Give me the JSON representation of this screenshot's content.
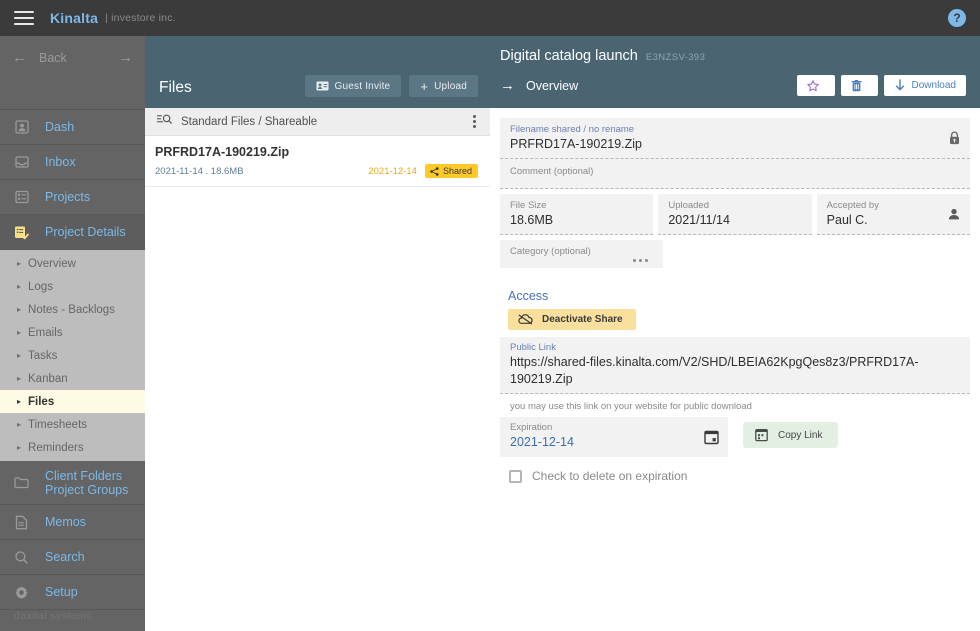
{
  "topbar": {
    "menu_icon": "hamburger-icon",
    "brand": "Kinalta",
    "brand_sub": "| investore inc.",
    "help_icon": "help-icon",
    "help_label": "?"
  },
  "sidebar": {
    "back": {
      "label": "Back",
      "left_icon": "arrow-left-icon",
      "right_icon": "arrow-right-icon"
    },
    "main_items": [
      {
        "label": "Dash",
        "icon": "person-badge-icon",
        "active": false
      },
      {
        "label": "Inbox",
        "icon": "inbox-icon",
        "active": false
      },
      {
        "label": "Projects",
        "icon": "list-grid-icon",
        "active": false
      },
      {
        "label": "Project Details",
        "icon": "checklist-icon",
        "active": true
      }
    ],
    "sub_items": [
      {
        "label": "Overview",
        "active": false
      },
      {
        "label": "Logs",
        "active": false
      },
      {
        "label": "Notes - Backlogs",
        "active": false
      },
      {
        "label": "Emails",
        "active": false
      },
      {
        "label": "Tasks",
        "active": false
      },
      {
        "label": "Kanban",
        "active": false
      },
      {
        "label": "Files",
        "active": true
      },
      {
        "label": "Timesheets",
        "active": false
      },
      {
        "label": "Reminders",
        "active": false
      }
    ],
    "bottom_items": [
      {
        "label_line1": "Client Folders",
        "label_line2": "Project Groups",
        "icon": "folder-icon"
      },
      {
        "label_line1": "Memos",
        "label_line2": "",
        "icon": "document-icon"
      },
      {
        "label_line1": "Search",
        "label_line2": "",
        "icon": "search-icon"
      },
      {
        "label_line1": "Setup",
        "label_line2": "",
        "icon": "gear-icon"
      }
    ],
    "footer": "daxital systems"
  },
  "files_panel": {
    "title": "Files",
    "guest_invite_label": "Guest Invite",
    "guest_invite_icon": "id-card-icon",
    "upload_label": "Upload",
    "upload_icon": "plus-icon",
    "filter_label": "Standard Files / Shareable",
    "filter_icon": "search-list-icon",
    "kebab_icon": "kebab-menu-icon",
    "rows": [
      {
        "name": "PRFRD17A-190219.Zip",
        "meta": "2021-11-14 . 18.6MB",
        "expiration": "2021-12-14",
        "badge": "Shared",
        "badge_icon": "share-icon"
      }
    ]
  },
  "detail": {
    "title": "Digital catalog launch",
    "code": "E3NZSV-393",
    "overview_label": "Overview",
    "overview_icon": "arrow-right-icon",
    "actions": [
      {
        "name": "favorite",
        "icon": "star-icon",
        "label": ""
      },
      {
        "name": "delete",
        "icon": "trash-icon",
        "label": ""
      },
      {
        "name": "download",
        "icon": "download-arrow-icon",
        "label": "Download"
      }
    ],
    "fields": {
      "filename_label": "Filename shared / no rename",
      "filename_value": "PRFRD17A-190219.Zip",
      "filename_icon": "lock-icon",
      "comment_placeholder": "Comment (optional)",
      "file_size_label": "File Size",
      "file_size_value": "18.6MB",
      "uploaded_label": "Uploaded",
      "uploaded_value": "2021/11/14",
      "accepted_by_label": "Accepted by",
      "accepted_by_value": "Paul C.",
      "accepted_by_icon": "person-icon",
      "category_placeholder": "Category (optional)",
      "category_icon": "ellipsis-icon"
    },
    "access": {
      "title": "Access",
      "deactivate_label": "Deactivate Share",
      "deactivate_icon": "cloud-off-icon",
      "public_link_label": "Public Link",
      "public_link_value": "https://shared-files.kinalta.com/V2/SHD/LBEIA62KpgQes8z3/PRFRD17A-190219.Zip",
      "link_hint": "you may use this link on your website for public download",
      "expiration_label": "Expiration",
      "expiration_value": "2021-12-14",
      "calendar_icon": "calendar-icon",
      "copy_link_label": "Copy Link",
      "copy_link_icon": "calendar-copy-icon",
      "delete_checkbox_label": "Check to delete on expiration",
      "delete_checkbox_checked": false
    }
  },
  "colors": {
    "topbar": "#3b3b3b",
    "sidebar": "#646464",
    "sidebar_sub": "#bdbdbd",
    "panel_header": "#4a6471",
    "accent_blue": "#7cb9e8",
    "active_sub": "#fdfbe3",
    "badge_yellow": "#ffc928",
    "deactivate_yellow": "#fbdf9c",
    "copy_green": "#e4efe4"
  }
}
